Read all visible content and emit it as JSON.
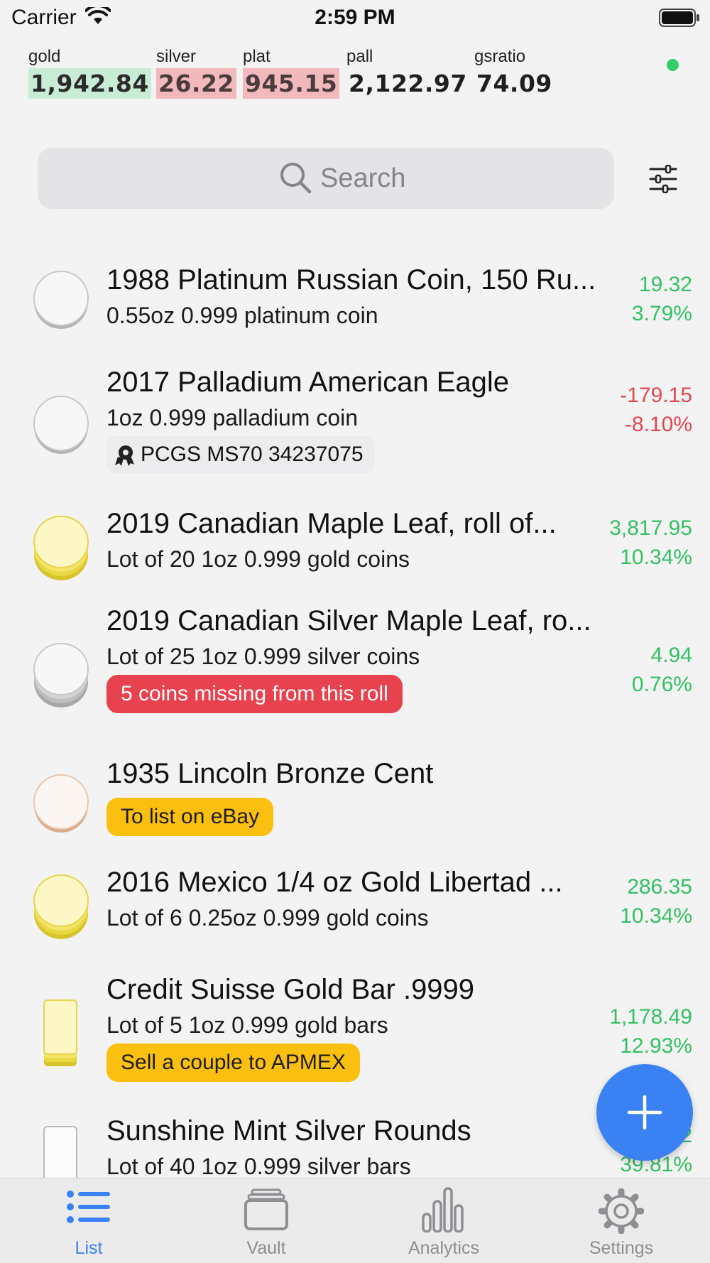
{
  "status_bar": {
    "carrier": "Carrier",
    "time": "2:59 PM"
  },
  "ticker": [
    {
      "label": "gold",
      "value": "1,942.84",
      "trend": "up"
    },
    {
      "label": "silver",
      "value": "26.22",
      "trend": "down"
    },
    {
      "label": "plat",
      "value": "945.15",
      "trend": "down"
    },
    {
      "label": "pall",
      "value": "2,122.97",
      "trend": "none"
    },
    {
      "label": "gsratio",
      "value": "74.09",
      "trend": "none"
    }
  ],
  "search": {
    "placeholder": "Search"
  },
  "items": [
    {
      "title": "1988 Platinum Russian Coin, 150 Ru...",
      "subtitle": "0.55oz 0.999 platinum coin",
      "gain": "19.32",
      "pct": "3.79%",
      "status": "positive",
      "thumb": "silver-coin-icon"
    },
    {
      "title": "2017 Palladium American Eagle",
      "subtitle": "1oz 0.999 palladium coin",
      "cert": "PCGS MS70 34237075",
      "gain": "-179.15",
      "pct": "-8.10%",
      "status": "negative",
      "thumb": "silver-coin-icon"
    },
    {
      "title": "2019 Canadian Maple Leaf, roll of...",
      "subtitle": "Lot of 20 1oz 0.999 gold coins",
      "gain": "3,817.95",
      "pct": "10.34%",
      "status": "positive",
      "thumb": "gold-coin-stack-icon"
    },
    {
      "title": "2019 Canadian Silver Maple Leaf, ro...",
      "subtitle": "Lot of 25 1oz 0.999 silver coins",
      "note": "5 coins missing from this roll",
      "note_color": "#e8424f",
      "gain": "4.94",
      "pct": "0.76%",
      "status": "positive",
      "thumb": "silver-coin-stack-icon"
    },
    {
      "title": "1935 Lincoln Bronze Cent",
      "note": "To list on eBay",
      "note_color": "#fbbf10",
      "thumb": "bronze-coin-icon"
    },
    {
      "title": "2016 Mexico 1/4 oz Gold Libertad ...",
      "subtitle": "Lot of 6 0.25oz 0.999 gold coins",
      "gain": "286.35",
      "pct": "10.34%",
      "status": "positive",
      "thumb": "gold-coin-stack-icon"
    },
    {
      "title": "Credit Suisse Gold Bar .9999",
      "subtitle": "Lot of 5 1oz 0.999 gold bars",
      "note": "Sell a couple to APMEX",
      "note_color": "#fbbf10",
      "gain": "1,178.49",
      "pct": "12.93%",
      "status": "positive",
      "thumb": "gold-bar-stack-icon"
    },
    {
      "title": "Sunshine Mint Silver Rounds",
      "subtitle": "Lot of 40 1oz 0.999 silver bars",
      "gain": "2",
      "pct": "39.81%",
      "status": "positive",
      "thumb": "silver-bar-icon"
    }
  ],
  "fab": {
    "icon": "plus-icon"
  },
  "tabs": [
    {
      "label": "List",
      "icon": "list-icon",
      "active": true
    },
    {
      "label": "Vault",
      "icon": "vault-icon",
      "active": false
    },
    {
      "label": "Analytics",
      "icon": "analytics-icon",
      "active": false
    },
    {
      "label": "Settings",
      "icon": "gear-icon",
      "active": false
    }
  ],
  "colors": {
    "accent": "#3a82f4",
    "positive": "#33c163",
    "negative": "#e0474f",
    "up_bg": "#c9ecd4",
    "down_bg": "#f2b9bc"
  }
}
